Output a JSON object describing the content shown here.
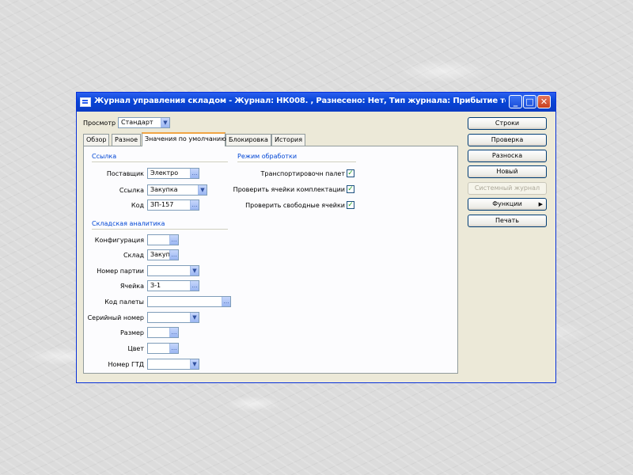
{
  "window": {
    "title": "Журнал управления складом - Журнал: НК008. , Разнесено: Нет, Тип журнала: Прибытие товара Но…",
    "minimize_glyph": "_",
    "maximize_glyph": "□",
    "close_glyph": "✕"
  },
  "view": {
    "label": "Просмотр",
    "value": "Стандарт"
  },
  "tabs": [
    "Обзор",
    "Разное",
    "Значения по умолчанию",
    "Блокировка",
    "История"
  ],
  "groups": {
    "sources": "Ссылка",
    "processing": "Режим обработки",
    "dimensions": "Складская аналитика"
  },
  "sources": {
    "supplier_label": "Поставщик",
    "supplier_value": "Электро",
    "reference_label": "Ссылка",
    "reference_value": "Закупка",
    "code_label": "Код",
    "code_value": "ЗП-157"
  },
  "processing": {
    "transport_label": "Транспортировочн палет",
    "check_cells_label": "Проверить ячейки комплектации",
    "check_free_label": "Проверить свободные ячейки"
  },
  "dimensions": {
    "configuration_label": "Конфигурация",
    "warehouse_label": "Склад",
    "warehouse_value": "Закуп",
    "batch_label": "Номер партии",
    "cell_label": "Ячейка",
    "cell_value": "З-1",
    "pallet_label": "Код палеты",
    "serial_label": "Серийный номер",
    "size_label": "Размер",
    "color_label": "Цвет",
    "gtd_label": "Номер ГТД"
  },
  "buttons": {
    "lines": "Строки",
    "check": "Проверка",
    "post": "Разноска",
    "new": "Новый",
    "system_journal": "Системный журнал",
    "functions": "Функции",
    "print": "Печать"
  },
  "icons": {
    "dropdown": "▼",
    "lookup": "…",
    "arrow_right": "▶",
    "check": "✓"
  }
}
